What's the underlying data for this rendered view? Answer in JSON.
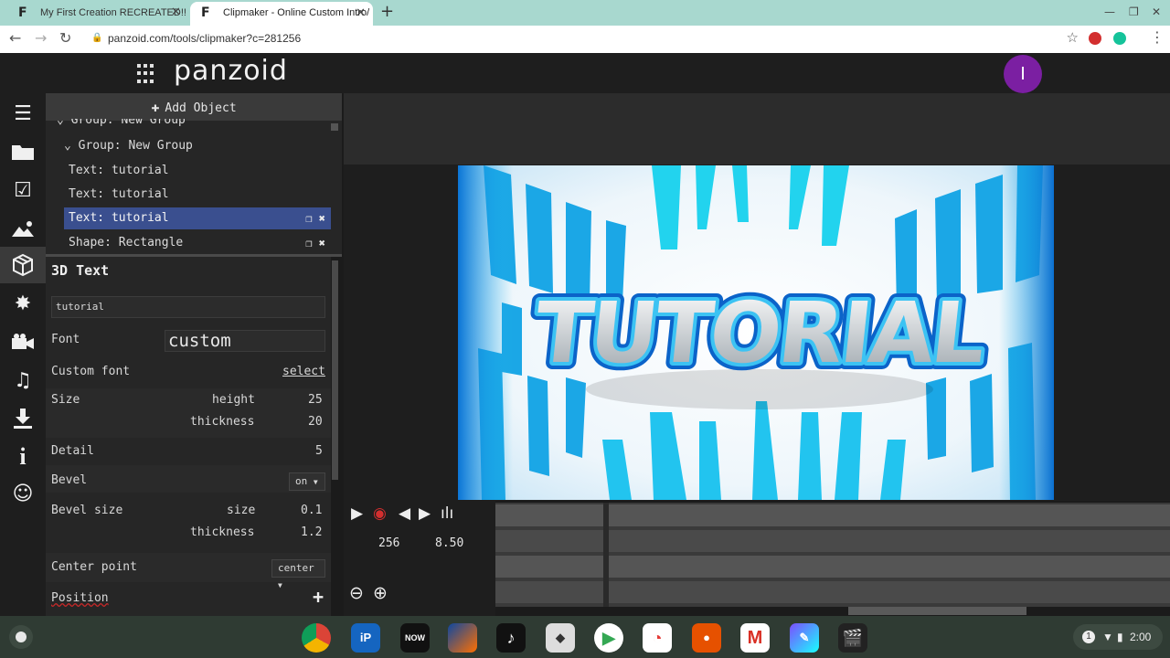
{
  "browser": {
    "tabs": [
      {
        "title": "My First Creation RECREATED!! -",
        "active": false
      },
      {
        "title": "Clipmaker - Online Custom Intro/",
        "active": true
      }
    ],
    "url": "panzoid.com/tools/clipmaker?c=281256"
  },
  "app": {
    "logo": "panzoid",
    "user_initial": "I"
  },
  "rail": {
    "icons": [
      "menu-icon",
      "folder-icon",
      "checkbox-icon",
      "image-icon",
      "cube-icon",
      "burst-icon",
      "camera-icon",
      "music-icon",
      "download-icon",
      "info-icon",
      "smile-icon"
    ]
  },
  "objects": {
    "add_label": "Add Object",
    "rows": [
      {
        "label": "Group: New Group",
        "indent": 1,
        "chevron": true
      },
      {
        "label": "Group: New Group",
        "indent": 2,
        "chevron": true
      },
      {
        "label": "Text: tutorial",
        "indent": 3,
        "chevron": false
      },
      {
        "label": "Text: tutorial",
        "indent": 3,
        "chevron": false
      },
      {
        "label": "Text: tutorial",
        "indent": 3,
        "chevron": false,
        "selected": true
      },
      {
        "label": "Shape: Rectangle",
        "indent": 3,
        "chevron": false
      }
    ]
  },
  "props": {
    "title": "3D Text",
    "text_value": "tutorial",
    "font_label": "Font",
    "font_value": "custom",
    "custom_font_label": "Custom font",
    "custom_font_action": "select",
    "size_label": "Size",
    "height_label": "height",
    "height_value": "25",
    "thickness_label": "thickness",
    "thickness_value": "20",
    "detail_label": "Detail",
    "detail_value": "5",
    "bevel_label": "Bevel",
    "bevel_value": "on",
    "bevel_size_label": "Bevel size",
    "bevel_size_size_label": "size",
    "bevel_size_size_value": "0.1",
    "bevel_size_thickness_label": "thickness",
    "bevel_size_thickness_value": "1.2",
    "center_label": "Center point",
    "center_value": "center",
    "position_label": "Position"
  },
  "preview": {
    "title_text": "TUTORIAL",
    "colors": {
      "cyan": "#22d3ee",
      "blue": "#0a74d6",
      "white": "#f4f4f4"
    }
  },
  "transport": {
    "frame": "256",
    "time": "8.50"
  },
  "shelf": {
    "time": "2:00",
    "notifications": "1"
  }
}
